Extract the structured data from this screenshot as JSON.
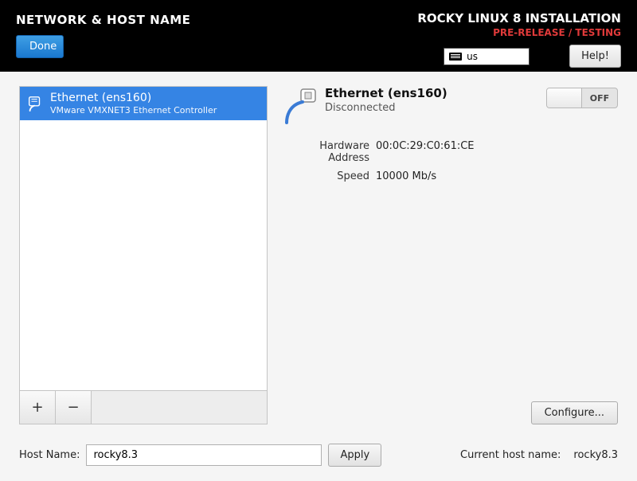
{
  "header": {
    "title": "NETWORK & HOST NAME",
    "done_label": "Done",
    "installer_title": "ROCKY LINUX 8 INSTALLATION",
    "installer_subtitle": "PRE-RELEASE / TESTING",
    "keyboard_layout": "us",
    "help_label": "Help!"
  },
  "nic_list": {
    "items": [
      {
        "title": "Ethernet (ens160)",
        "subtitle": "VMware VMXNET3 Ethernet Controller"
      }
    ],
    "add_label": "+",
    "remove_label": "−"
  },
  "detail": {
    "title": "Ethernet (ens160)",
    "status": "Disconnected",
    "toggle_state": "OFF",
    "hw_label": "Hardware Address",
    "hw_value": "00:0C:29:C0:61:CE",
    "speed_label": "Speed",
    "speed_value": "10000 Mb/s",
    "configure_label": "Configure..."
  },
  "hostname": {
    "label": "Host Name:",
    "value": "rocky8.3",
    "apply_label": "Apply",
    "current_label": "Current host name:",
    "current_value": "rocky8.3"
  }
}
